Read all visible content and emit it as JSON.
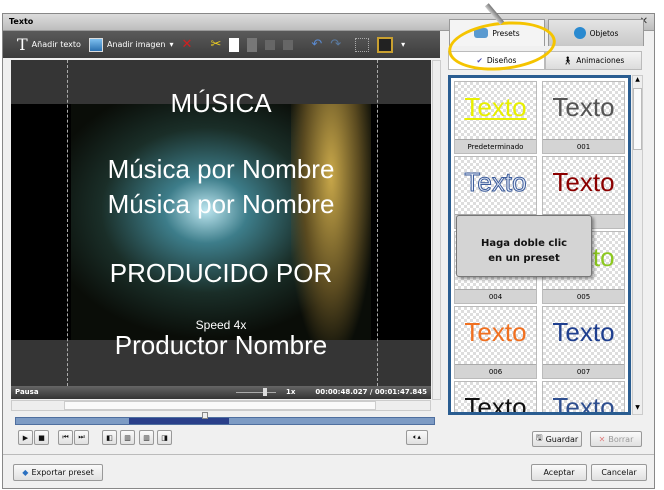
{
  "window": {
    "title": "Texto",
    "controls": "_ ✕"
  },
  "toolbar": {
    "add_text": "Añadir texto",
    "add_image": "Anadir imagen"
  },
  "video": {
    "lines": [
      "MÚSICA",
      "Música por Nombre",
      "Música por Nombre",
      "PRODUCIDO POR",
      "Speed 4x",
      "Productor Nombre"
    ]
  },
  "status": {
    "state": "Pausa",
    "speed": "1x",
    "time": "00:00:48.027 / 00:01:47.845"
  },
  "tabs": {
    "presets": "Presets",
    "objects": "Objetos"
  },
  "subtabs": {
    "designs": "Diseños",
    "animations": "Animaciones"
  },
  "presets": [
    {
      "label": "Predeterminado",
      "color": "#e8f000"
    },
    {
      "label": "001",
      "color": "#555555"
    },
    {
      "label": "",
      "color": "#e8eef8"
    },
    {
      "label": "",
      "color": "#8b0000"
    },
    {
      "label": "004",
      "color": "#301040"
    },
    {
      "label": "005",
      "color": "#8cc820"
    },
    {
      "label": "006",
      "color": "#f07020"
    },
    {
      "label": "007",
      "color": "#1f3f8f"
    },
    {
      "label": "",
      "color": "#111111"
    },
    {
      "label": "",
      "color": "#2f4f8f"
    }
  ],
  "preset_sample": "Texto",
  "callout": {
    "line1": "Haga doble clic",
    "line2": "en un preset"
  },
  "buttons": {
    "save": "Guardar",
    "delete": "Borrar",
    "export": "Exportar preset",
    "accept": "Aceptar",
    "cancel": "Cancelar"
  }
}
